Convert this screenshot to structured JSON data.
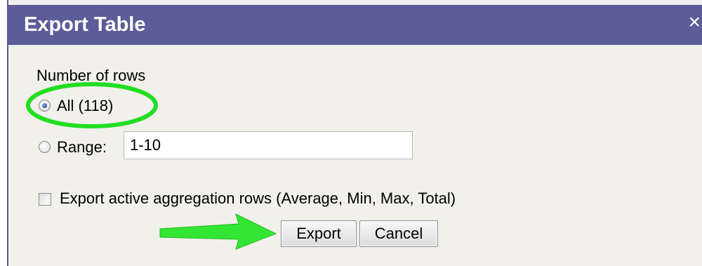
{
  "dialog": {
    "title": "Export Table",
    "close_glyph": "×"
  },
  "rows": {
    "section_label": "Number of rows",
    "all_label": "All (118)",
    "all_selected": true,
    "range_label": "Range:",
    "range_value": "1-10"
  },
  "options": {
    "aggregation_label": "Export active aggregation rows (Average, Min, Max, Total)",
    "aggregation_checked": false
  },
  "buttons": {
    "export_label": "Export",
    "cancel_label": "Cancel"
  },
  "annotations": {
    "highlight_color": "#22dd22",
    "arrow_color": "#33e633"
  }
}
